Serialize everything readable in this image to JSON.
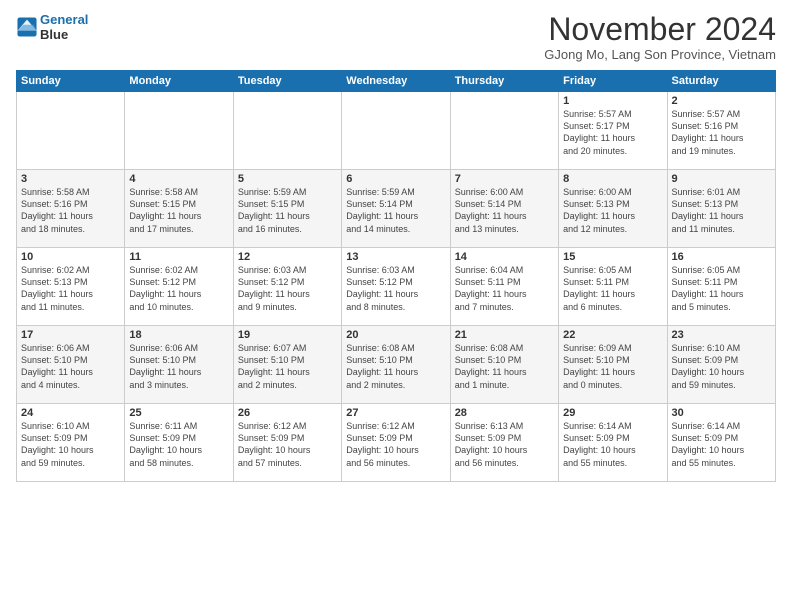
{
  "header": {
    "logo_line1": "General",
    "logo_line2": "Blue",
    "month_title": "November 2024",
    "location": "GJong Mo, Lang Son Province, Vietnam"
  },
  "weekdays": [
    "Sunday",
    "Monday",
    "Tuesday",
    "Wednesday",
    "Thursday",
    "Friday",
    "Saturday"
  ],
  "weeks": [
    [
      {
        "day": "",
        "info": ""
      },
      {
        "day": "",
        "info": ""
      },
      {
        "day": "",
        "info": ""
      },
      {
        "day": "",
        "info": ""
      },
      {
        "day": "",
        "info": ""
      },
      {
        "day": "1",
        "info": "Sunrise: 5:57 AM\nSunset: 5:17 PM\nDaylight: 11 hours\nand 20 minutes."
      },
      {
        "day": "2",
        "info": "Sunrise: 5:57 AM\nSunset: 5:16 PM\nDaylight: 11 hours\nand 19 minutes."
      }
    ],
    [
      {
        "day": "3",
        "info": "Sunrise: 5:58 AM\nSunset: 5:16 PM\nDaylight: 11 hours\nand 18 minutes."
      },
      {
        "day": "4",
        "info": "Sunrise: 5:58 AM\nSunset: 5:15 PM\nDaylight: 11 hours\nand 17 minutes."
      },
      {
        "day": "5",
        "info": "Sunrise: 5:59 AM\nSunset: 5:15 PM\nDaylight: 11 hours\nand 16 minutes."
      },
      {
        "day": "6",
        "info": "Sunrise: 5:59 AM\nSunset: 5:14 PM\nDaylight: 11 hours\nand 14 minutes."
      },
      {
        "day": "7",
        "info": "Sunrise: 6:00 AM\nSunset: 5:14 PM\nDaylight: 11 hours\nand 13 minutes."
      },
      {
        "day": "8",
        "info": "Sunrise: 6:00 AM\nSunset: 5:13 PM\nDaylight: 11 hours\nand 12 minutes."
      },
      {
        "day": "9",
        "info": "Sunrise: 6:01 AM\nSunset: 5:13 PM\nDaylight: 11 hours\nand 11 minutes."
      }
    ],
    [
      {
        "day": "10",
        "info": "Sunrise: 6:02 AM\nSunset: 5:13 PM\nDaylight: 11 hours\nand 11 minutes."
      },
      {
        "day": "11",
        "info": "Sunrise: 6:02 AM\nSunset: 5:12 PM\nDaylight: 11 hours\nand 10 minutes."
      },
      {
        "day": "12",
        "info": "Sunrise: 6:03 AM\nSunset: 5:12 PM\nDaylight: 11 hours\nand 9 minutes."
      },
      {
        "day": "13",
        "info": "Sunrise: 6:03 AM\nSunset: 5:12 PM\nDaylight: 11 hours\nand 8 minutes."
      },
      {
        "day": "14",
        "info": "Sunrise: 6:04 AM\nSunset: 5:11 PM\nDaylight: 11 hours\nand 7 minutes."
      },
      {
        "day": "15",
        "info": "Sunrise: 6:05 AM\nSunset: 5:11 PM\nDaylight: 11 hours\nand 6 minutes."
      },
      {
        "day": "16",
        "info": "Sunrise: 6:05 AM\nSunset: 5:11 PM\nDaylight: 11 hours\nand 5 minutes."
      }
    ],
    [
      {
        "day": "17",
        "info": "Sunrise: 6:06 AM\nSunset: 5:10 PM\nDaylight: 11 hours\nand 4 minutes."
      },
      {
        "day": "18",
        "info": "Sunrise: 6:06 AM\nSunset: 5:10 PM\nDaylight: 11 hours\nand 3 minutes."
      },
      {
        "day": "19",
        "info": "Sunrise: 6:07 AM\nSunset: 5:10 PM\nDaylight: 11 hours\nand 2 minutes."
      },
      {
        "day": "20",
        "info": "Sunrise: 6:08 AM\nSunset: 5:10 PM\nDaylight: 11 hours\nand 2 minutes."
      },
      {
        "day": "21",
        "info": "Sunrise: 6:08 AM\nSunset: 5:10 PM\nDaylight: 11 hours\nand 1 minute."
      },
      {
        "day": "22",
        "info": "Sunrise: 6:09 AM\nSunset: 5:10 PM\nDaylight: 11 hours\nand 0 minutes."
      },
      {
        "day": "23",
        "info": "Sunrise: 6:10 AM\nSunset: 5:09 PM\nDaylight: 10 hours\nand 59 minutes."
      }
    ],
    [
      {
        "day": "24",
        "info": "Sunrise: 6:10 AM\nSunset: 5:09 PM\nDaylight: 10 hours\nand 59 minutes."
      },
      {
        "day": "25",
        "info": "Sunrise: 6:11 AM\nSunset: 5:09 PM\nDaylight: 10 hours\nand 58 minutes."
      },
      {
        "day": "26",
        "info": "Sunrise: 6:12 AM\nSunset: 5:09 PM\nDaylight: 10 hours\nand 57 minutes."
      },
      {
        "day": "27",
        "info": "Sunrise: 6:12 AM\nSunset: 5:09 PM\nDaylight: 10 hours\nand 56 minutes."
      },
      {
        "day": "28",
        "info": "Sunrise: 6:13 AM\nSunset: 5:09 PM\nDaylight: 10 hours\nand 56 minutes."
      },
      {
        "day": "29",
        "info": "Sunrise: 6:14 AM\nSunset: 5:09 PM\nDaylight: 10 hours\nand 55 minutes."
      },
      {
        "day": "30",
        "info": "Sunrise: 6:14 AM\nSunset: 5:09 PM\nDaylight: 10 hours\nand 55 minutes."
      }
    ]
  ]
}
